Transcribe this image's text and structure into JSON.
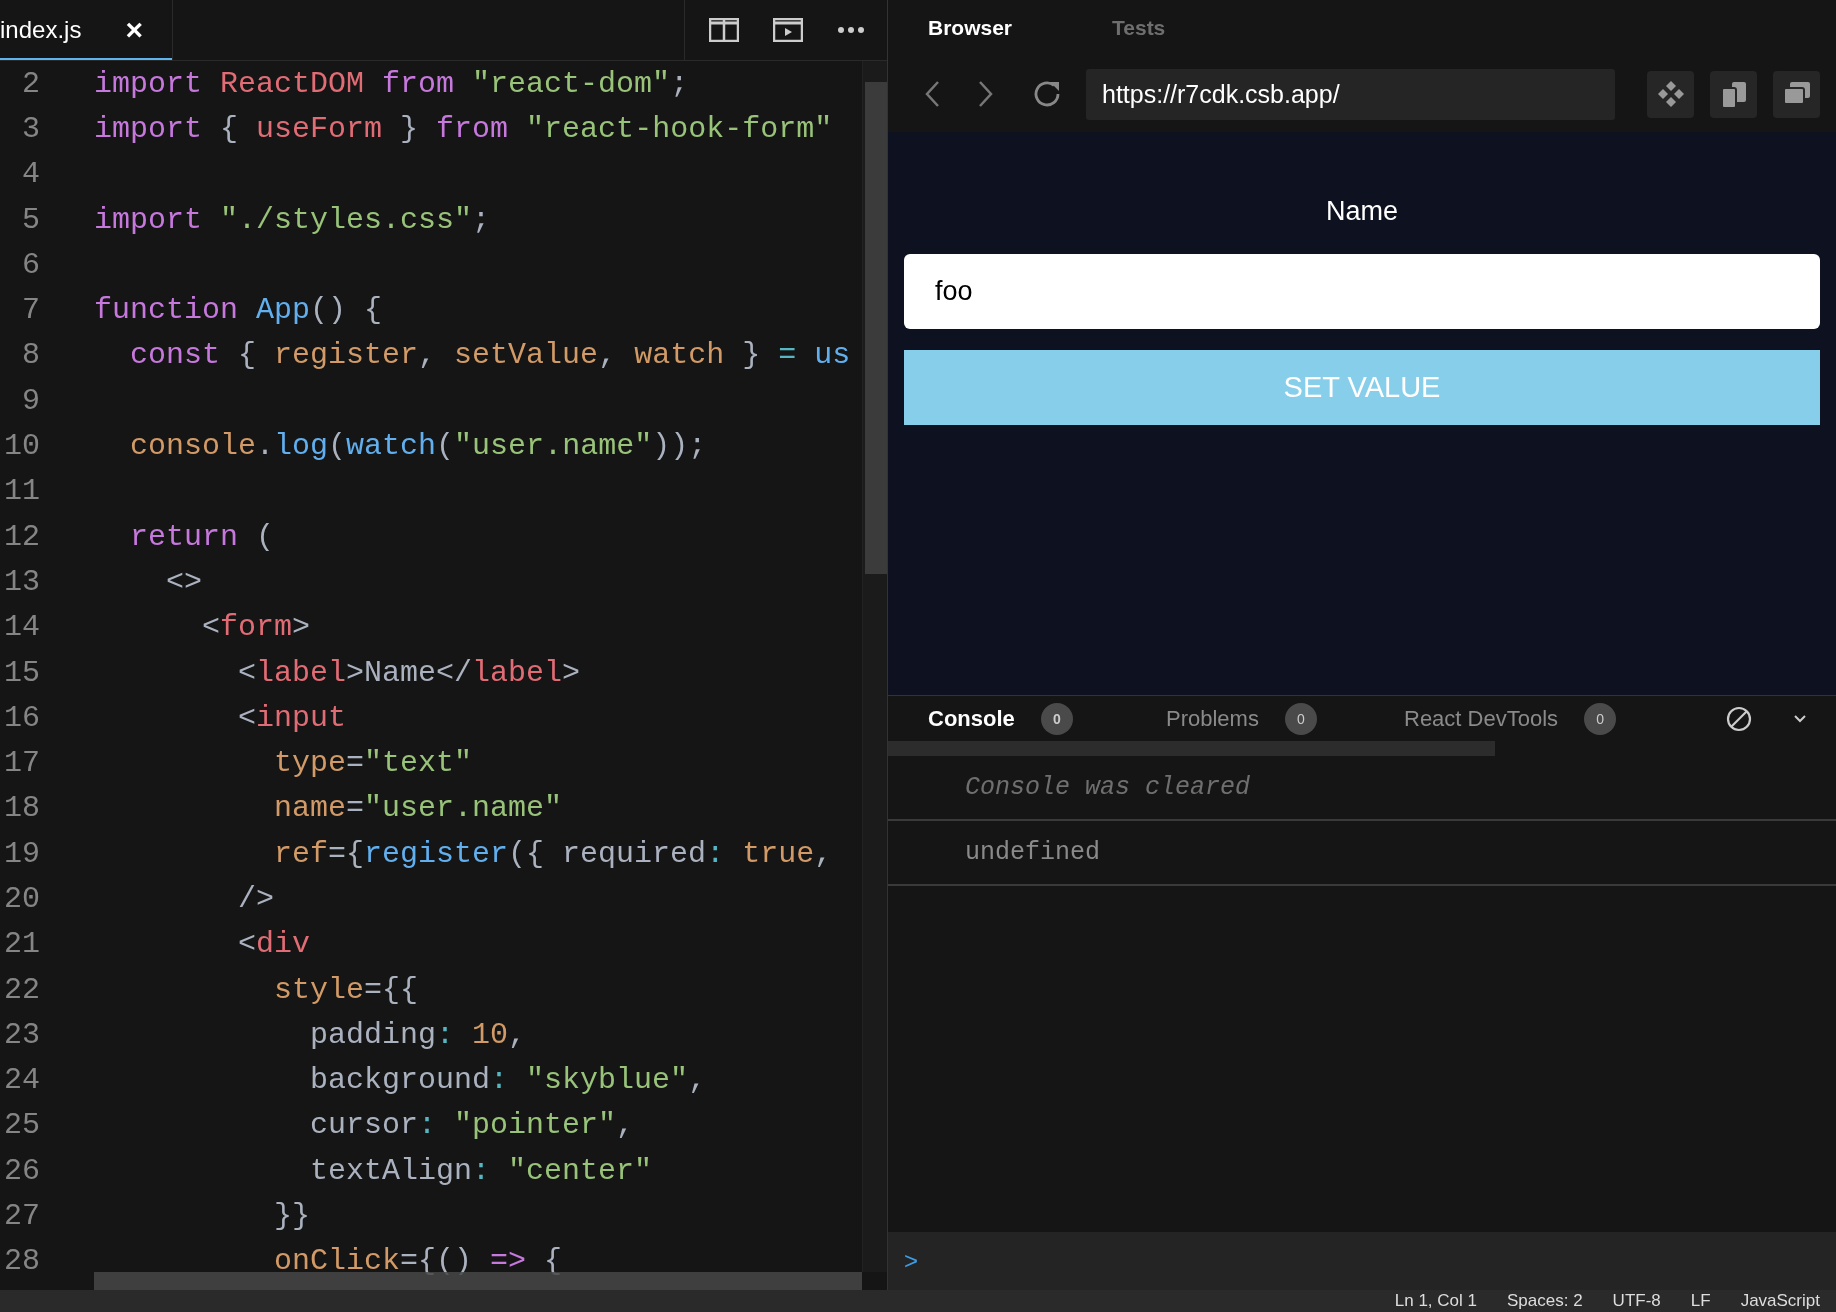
{
  "editor": {
    "tab": {
      "label": "index.js",
      "close": "×",
      "selected": true
    },
    "lines": [
      {
        "number": "2",
        "tokens": [
          {
            "text": "import ",
            "kind": "keyword"
          },
          {
            "text": "ReactDOM ",
            "kind": "variable"
          },
          {
            "text": "from ",
            "kind": "keyword"
          },
          {
            "text": "\"react-dom\"",
            "kind": "string"
          },
          {
            "text": ";",
            "kind": "plain"
          }
        ]
      },
      {
        "number": "3",
        "tokens": [
          {
            "text": "import ",
            "kind": "keyword"
          },
          {
            "text": "{ ",
            "kind": "plain"
          },
          {
            "text": "useForm ",
            "kind": "variable"
          },
          {
            "text": "} ",
            "kind": "plain"
          },
          {
            "text": "from ",
            "kind": "keyword"
          },
          {
            "text": "\"react-hook-form\"",
            "kind": "string"
          }
        ]
      },
      {
        "number": "4"
      },
      {
        "number": "5",
        "tokens": [
          {
            "text": "import ",
            "kind": "keyword"
          },
          {
            "text": "\"./styles.css\"",
            "kind": "string"
          },
          {
            "text": ";",
            "kind": "plain"
          }
        ]
      },
      {
        "number": "6"
      },
      {
        "number": "7",
        "tokens": [
          {
            "text": "function ",
            "kind": "keyword"
          },
          {
            "text": "App",
            "kind": "function"
          },
          {
            "text": "() {",
            "kind": "plain"
          }
        ]
      },
      {
        "number": "8",
        "tokens": [
          {
            "text": "  const ",
            "kind": "keyword"
          },
          {
            "text": "{ ",
            "kind": "plain"
          },
          {
            "text": "register",
            "kind": "property"
          },
          {
            "text": ", ",
            "kind": "plain"
          },
          {
            "text": "setValue",
            "kind": "property"
          },
          {
            "text": ", ",
            "kind": "plain"
          },
          {
            "text": "watch ",
            "kind": "property"
          },
          {
            "text": "} ",
            "kind": "plain"
          },
          {
            "text": "= ",
            "kind": "operator"
          },
          {
            "text": "us",
            "kind": "function"
          }
        ]
      },
      {
        "number": "9"
      },
      {
        "number": "10",
        "tokens": [
          {
            "text": "  console",
            "kind": "property"
          },
          {
            "text": ".",
            "kind": "plain"
          },
          {
            "text": "log",
            "kind": "function"
          },
          {
            "text": "(",
            "kind": "plain"
          },
          {
            "text": "watch",
            "kind": "function"
          },
          {
            "text": "(",
            "kind": "plain"
          },
          {
            "text": "\"user.name\"",
            "kind": "string"
          },
          {
            "text": "));",
            "kind": "plain"
          }
        ]
      },
      {
        "number": "11"
      },
      {
        "number": "12",
        "tokens": [
          {
            "text": "  return ",
            "kind": "keyword"
          },
          {
            "text": "(",
            "kind": "plain"
          }
        ]
      },
      {
        "number": "13",
        "tokens": [
          {
            "text": "    <>",
            "kind": "plain"
          }
        ]
      },
      {
        "number": "14",
        "tokens": [
          {
            "text": "      <",
            "kind": "plain"
          },
          {
            "text": "form",
            "kind": "tag"
          },
          {
            "text": ">",
            "kind": "plain"
          }
        ]
      },
      {
        "number": "15",
        "tokens": [
          {
            "text": "        <",
            "kind": "plain"
          },
          {
            "text": "label",
            "kind": "tag"
          },
          {
            "text": ">Name</",
            "kind": "plain"
          },
          {
            "text": "label",
            "kind": "tag"
          },
          {
            "text": ">",
            "kind": "plain"
          }
        ]
      },
      {
        "number": "16",
        "tokens": [
          {
            "text": "        <",
            "kind": "plain"
          },
          {
            "text": "input",
            "kind": "tag"
          }
        ]
      },
      {
        "number": "17",
        "tokens": [
          {
            "text": "          type",
            "kind": "property"
          },
          {
            "text": "=",
            "kind": "plain"
          },
          {
            "text": "\"text\"",
            "kind": "string"
          }
        ]
      },
      {
        "number": "18",
        "tokens": [
          {
            "text": "          name",
            "kind": "property"
          },
          {
            "text": "=",
            "kind": "plain"
          },
          {
            "text": "\"user.name\"",
            "kind": "string"
          }
        ]
      },
      {
        "number": "19",
        "tokens": [
          {
            "text": "          ref",
            "kind": "property"
          },
          {
            "text": "={",
            "kind": "plain"
          },
          {
            "text": "register",
            "kind": "function"
          },
          {
            "text": "({ required",
            "kind": "plain"
          },
          {
            "text": ": ",
            "kind": "operator"
          },
          {
            "text": "true",
            "kind": "property"
          },
          {
            "text": ",",
            "kind": "plain"
          }
        ]
      },
      {
        "number": "20",
        "tokens": [
          {
            "text": "        />",
            "kind": "plain"
          }
        ]
      },
      {
        "number": "21",
        "tokens": [
          {
            "text": "        <",
            "kind": "plain"
          },
          {
            "text": "div",
            "kind": "tag"
          }
        ]
      },
      {
        "number": "22",
        "tokens": [
          {
            "text": "          style",
            "kind": "property"
          },
          {
            "text": "={{",
            "kind": "plain"
          }
        ]
      },
      {
        "number": "23",
        "tokens": [
          {
            "text": "            padding",
            "kind": "plain"
          },
          {
            "text": ": ",
            "kind": "operator"
          },
          {
            "text": "10",
            "kind": "property"
          },
          {
            "text": ",",
            "kind": "plain"
          }
        ]
      },
      {
        "number": "24",
        "tokens": [
          {
            "text": "            background",
            "kind": "plain"
          },
          {
            "text": ": ",
            "kind": "operator"
          },
          {
            "text": "\"skyblue\"",
            "kind": "string"
          },
          {
            "text": ",",
            "kind": "plain"
          }
        ]
      },
      {
        "number": "25",
        "tokens": [
          {
            "text": "            cursor",
            "kind": "plain"
          },
          {
            "text": ": ",
            "kind": "operator"
          },
          {
            "text": "\"pointer\"",
            "kind": "string"
          },
          {
            "text": ",",
            "kind": "plain"
          }
        ]
      },
      {
        "number": "26",
        "tokens": [
          {
            "text": "            textAlign",
            "kind": "plain"
          },
          {
            "text": ": ",
            "kind": "operator"
          },
          {
            "text": "\"center\"",
            "kind": "string"
          }
        ]
      },
      {
        "number": "27",
        "tokens": [
          {
            "text": "          }}",
            "kind": "plain"
          }
        ]
      },
      {
        "number": "28",
        "tokens": [
          {
            "text": "          onClick",
            "kind": "property"
          },
          {
            "text": "={() ",
            "kind": "plain"
          },
          {
            "text": "=> ",
            "kind": "keyword"
          },
          {
            "text": "{",
            "kind": "plain"
          }
        ]
      }
    ]
  },
  "browser": {
    "tabs": [
      {
        "label": "Browser",
        "selected": true
      },
      {
        "label": "Tests",
        "selected": false
      }
    ],
    "url": "https://r7cdk.csb.app/",
    "preview": {
      "label": "Name",
      "input_value": "foo",
      "button": "SET VALUE"
    }
  },
  "console": {
    "tabs": [
      {
        "label": "Console",
        "count": "0",
        "selected": true
      },
      {
        "label": "Problems",
        "count": "0",
        "selected": false
      },
      {
        "label": "React DevTools",
        "count": "0",
        "selected": false
      }
    ],
    "messages": [
      {
        "text": "Console was cleared",
        "kind": "info"
      },
      {
        "text": "undefined",
        "kind": "log"
      }
    ],
    "prompt": ">"
  },
  "status_bar": [
    "Ln 1, Col 1",
    "Spaces: 2",
    "UTF-8",
    "LF",
    "JavaScript"
  ]
}
